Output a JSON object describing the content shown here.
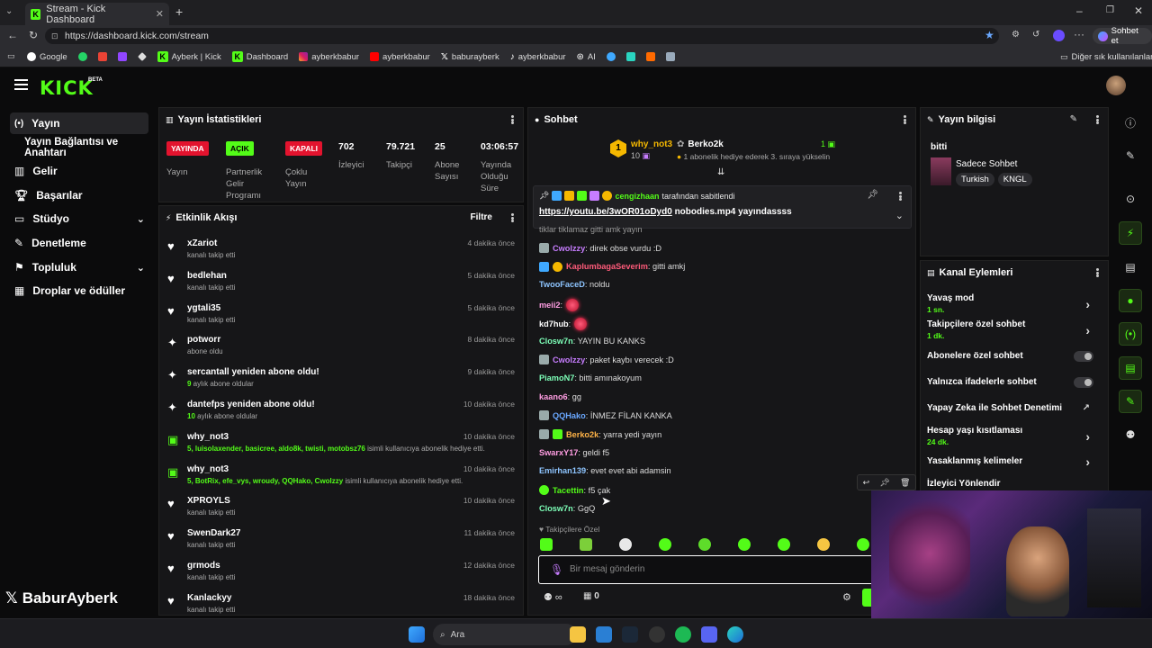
{
  "browser": {
    "tab_title": "Stream - Kick Dashboard",
    "url": "https://dashboard.kick.com/stream",
    "profile_label": "Sohbet et",
    "bookmarks": [
      "Google",
      "Ayberk | Kick",
      "Dashboard",
      "ayberkbabur",
      "ayberkbabur",
      "baburayberk",
      "ayberkbabur",
      "AI"
    ],
    "other_bookmarks": "Diğer sık kullanılanlar"
  },
  "brand": {
    "logo": "KICK",
    "beta": "BETA",
    "accent": "#53fc18"
  },
  "sidebar": {
    "items": [
      "Yayın",
      "Yayın Bağlantısı ve Anahtarı",
      "Gelir",
      "Başarılar",
      "Stüdyo",
      "Denetleme",
      "Topluluk",
      "Droplar ve ödüller"
    ]
  },
  "stats": {
    "title": "Yayın İstatistikleri",
    "badges": [
      {
        "text": "YAYINDA",
        "label": "Yayın",
        "color": "#e3132e"
      },
      {
        "text": "AÇIK",
        "label": "Partnerlik Gelir Programı",
        "color": "#53fc18"
      },
      {
        "text": "KAPALI",
        "label": "Çoklu Yayın",
        "color": "#e3132e"
      }
    ],
    "numbers": [
      {
        "value": "702",
        "label": "İzleyici"
      },
      {
        "value": "79.721",
        "label": "Takipçi"
      },
      {
        "value": "25",
        "label": "Abone Sayısı"
      },
      {
        "value": "03:06:57",
        "label": "Yayında Olduğu Süre"
      }
    ]
  },
  "activity": {
    "title": "Etkinlik Akışı",
    "filter": "Filtre",
    "items": [
      {
        "icon": "heart",
        "name": "xZariot",
        "sub": "kanalı takip etti",
        "time": "4 dakika önce"
      },
      {
        "icon": "heart",
        "name": "bedlehan",
        "sub": "kanalı takip etti",
        "time": "5 dakika önce"
      },
      {
        "icon": "heart",
        "name": "ygtali35",
        "sub": "kanalı takip etti",
        "time": "5 dakika önce"
      },
      {
        "icon": "star",
        "name": "potworr",
        "sub": "abone oldu",
        "time": "8 dakika önce"
      },
      {
        "icon": "star",
        "name": "sercantall yeniden abone oldu!",
        "sub_num": "9",
        "sub": " aylık abone oldular",
        "time": "9 dakika önce"
      },
      {
        "icon": "star",
        "name": "dantefps yeniden abone oldu!",
        "sub_num": "10",
        "sub": " aylık abone oldular",
        "time": "10 dakika önce"
      },
      {
        "icon": "gift",
        "name": "why_not3",
        "sub_num": "5, luisolaxender, basicree, aldo8k, twisti, motobsz76",
        "sub": " isimli kullanıcıya abonelik hediye etti.",
        "time": "10 dakika önce"
      },
      {
        "icon": "gift",
        "name": "why_not3",
        "sub_num": "5, BotRix, efe_vys, wroudy, QQHako, Cwolzzy",
        "sub": " isimli kullanıcıya abonelik hediye etti.",
        "time": "10 dakika önce"
      },
      {
        "icon": "heart",
        "name": "XPROYLS",
        "sub": "kanalı takip etti",
        "time": "10 dakika önce"
      },
      {
        "icon": "heart",
        "name": "SwenDark27",
        "sub": "kanalı takip etti",
        "time": "11 dakika önce"
      },
      {
        "icon": "heart",
        "name": "grmods",
        "sub": "kanalı takip etti",
        "time": "12 dakika önce"
      },
      {
        "icon": "heart",
        "name": "Kanlackyy",
        "sub": "kanalı takip etti",
        "time": "18 dakika önce"
      }
    ]
  },
  "chat": {
    "title": "Sohbet",
    "gifter": "why_not3",
    "gifter_count": "10",
    "gift_target": "Berko2k",
    "gift_target_count": "1",
    "gift_note": "1 abonelik hediye ederek 3. sıraya yükselin",
    "pinned_by": "cengizhaan",
    "pinned_suffix": "tarafından sabitlendi",
    "pinned_link": "https://youtu.be/3wOR01oDyd0",
    "pinned_text": " nobodies.mp4 yayındassss",
    "cut_line": "tiklar tiklamaz gitti amk yayın",
    "messages": [
      {
        "user": "Cwolzzy",
        "color": "#c77dff",
        "text": ": direk obse vurdu :D"
      },
      {
        "user": "KaplumbagaSeverim",
        "color": "#ff5b7a",
        "text": ": gitti amkj"
      },
      {
        "user": "TwooFaceD",
        "color": "#8ec5ff",
        "text": ": noldu"
      },
      {
        "user": "meii2",
        "color": "#ff9de2",
        "text": ":"
      },
      {
        "user": "kd7hub",
        "color": "#ffffff",
        "text": ":"
      },
      {
        "user": "Closw7n",
        "color": "#7dffb8",
        "text": ": YAYIN BU KANKS"
      },
      {
        "user": "Cwolzzy",
        "color": "#c77dff",
        "text": ": paket kaybı verecek :D"
      },
      {
        "user": "PiamoN7",
        "color": "#7dffb8",
        "text": ": bitti amınakoyum"
      },
      {
        "user": "kaano6",
        "color": "#ff9de2",
        "text": ": gg"
      },
      {
        "user": "QQHako",
        "color": "#6aa8ff",
        "text": ": İNMEZ FİLAN KANKA"
      },
      {
        "user": "Berko2k",
        "color": "#ffb347",
        "text": ": yarra yedi yayın"
      },
      {
        "user": "SwarxY17",
        "color": "#ff9de2",
        "text": ": geldi f5"
      },
      {
        "user": "Emirhan139",
        "color": "#8ec5ff",
        "text": ": evet evet abi adamsin"
      },
      {
        "user": "Tacettin",
        "color": "#53fc18",
        "text": ": f5 çak"
      },
      {
        "user": "Closw7n",
        "color": "#7dffb8",
        "text": ": GgQ"
      }
    ],
    "followers_only": "Takipçilere Özel",
    "input_placeholder": "Bir mesaj gönderin",
    "points": "0"
  },
  "stream_info": {
    "title": "Yayın bilgisi",
    "stream_title": "bitti",
    "category": "Sadece Sohbet",
    "tags": [
      "Turkish",
      "KNGL"
    ]
  },
  "channel_actions": {
    "title": "Kanal Eylemleri",
    "items": [
      {
        "label": "Yavaş mod",
        "value": "1 sn.",
        "type": "chevron"
      },
      {
        "label": "Takipçilere özel sohbet",
        "value": "1 dk.",
        "type": "chevron"
      },
      {
        "label": "Abonelere özel sohbet",
        "value": "",
        "type": "toggle"
      },
      {
        "label": "Yalnızca ifadelerle sohbet",
        "value": "",
        "type": "toggle"
      },
      {
        "label": "Yapay Zeka ile Sohbet Denetimi",
        "value": "",
        "type": "external"
      },
      {
        "label": "Hesap yaşı kısıtlaması",
        "value": "24 dk.",
        "type": "chevron"
      },
      {
        "label": "Yasaklanmış kelimeler",
        "value": "",
        "type": "chevron"
      },
      {
        "label": "İzleyici Yönlendir",
        "value": "",
        "type": "none"
      }
    ]
  },
  "watermark": {
    "text": "BaburAyberk"
  },
  "taskbar": {
    "search": "Ara"
  }
}
